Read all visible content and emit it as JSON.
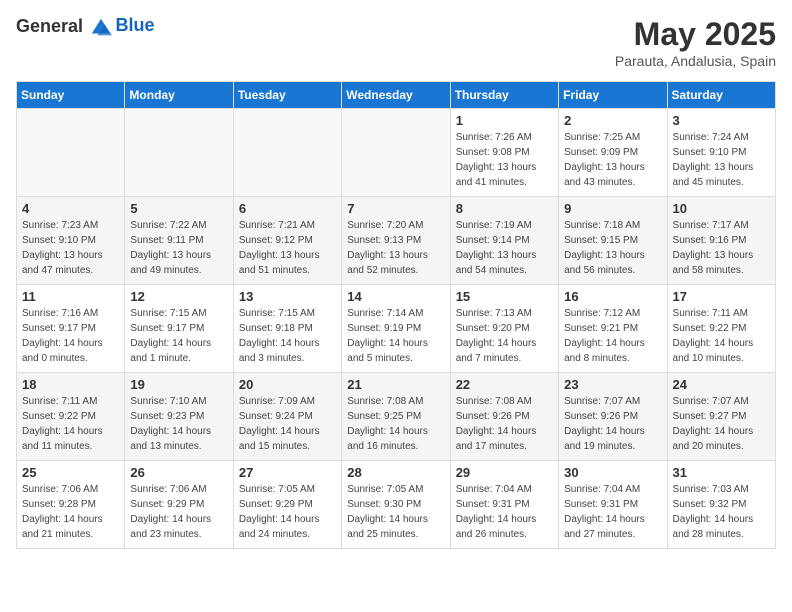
{
  "logo": {
    "general": "General",
    "blue": "Blue"
  },
  "title": "May 2025",
  "subtitle": "Parauta, Andalusia, Spain",
  "days_of_week": [
    "Sunday",
    "Monday",
    "Tuesday",
    "Wednesday",
    "Thursday",
    "Friday",
    "Saturday"
  ],
  "weeks": [
    [
      {
        "day": "",
        "info": ""
      },
      {
        "day": "",
        "info": ""
      },
      {
        "day": "",
        "info": ""
      },
      {
        "day": "",
        "info": ""
      },
      {
        "day": "1",
        "info": "Sunrise: 7:26 AM\nSunset: 9:08 PM\nDaylight: 13 hours\nand 41 minutes."
      },
      {
        "day": "2",
        "info": "Sunrise: 7:25 AM\nSunset: 9:09 PM\nDaylight: 13 hours\nand 43 minutes."
      },
      {
        "day": "3",
        "info": "Sunrise: 7:24 AM\nSunset: 9:10 PM\nDaylight: 13 hours\nand 45 minutes."
      }
    ],
    [
      {
        "day": "4",
        "info": "Sunrise: 7:23 AM\nSunset: 9:10 PM\nDaylight: 13 hours\nand 47 minutes."
      },
      {
        "day": "5",
        "info": "Sunrise: 7:22 AM\nSunset: 9:11 PM\nDaylight: 13 hours\nand 49 minutes."
      },
      {
        "day": "6",
        "info": "Sunrise: 7:21 AM\nSunset: 9:12 PM\nDaylight: 13 hours\nand 51 minutes."
      },
      {
        "day": "7",
        "info": "Sunrise: 7:20 AM\nSunset: 9:13 PM\nDaylight: 13 hours\nand 52 minutes."
      },
      {
        "day": "8",
        "info": "Sunrise: 7:19 AM\nSunset: 9:14 PM\nDaylight: 13 hours\nand 54 minutes."
      },
      {
        "day": "9",
        "info": "Sunrise: 7:18 AM\nSunset: 9:15 PM\nDaylight: 13 hours\nand 56 minutes."
      },
      {
        "day": "10",
        "info": "Sunrise: 7:17 AM\nSunset: 9:16 PM\nDaylight: 13 hours\nand 58 minutes."
      }
    ],
    [
      {
        "day": "11",
        "info": "Sunrise: 7:16 AM\nSunset: 9:17 PM\nDaylight: 14 hours\nand 0 minutes."
      },
      {
        "day": "12",
        "info": "Sunrise: 7:15 AM\nSunset: 9:17 PM\nDaylight: 14 hours\nand 1 minute."
      },
      {
        "day": "13",
        "info": "Sunrise: 7:15 AM\nSunset: 9:18 PM\nDaylight: 14 hours\nand 3 minutes."
      },
      {
        "day": "14",
        "info": "Sunrise: 7:14 AM\nSunset: 9:19 PM\nDaylight: 14 hours\nand 5 minutes."
      },
      {
        "day": "15",
        "info": "Sunrise: 7:13 AM\nSunset: 9:20 PM\nDaylight: 14 hours\nand 7 minutes."
      },
      {
        "day": "16",
        "info": "Sunrise: 7:12 AM\nSunset: 9:21 PM\nDaylight: 14 hours\nand 8 minutes."
      },
      {
        "day": "17",
        "info": "Sunrise: 7:11 AM\nSunset: 9:22 PM\nDaylight: 14 hours\nand 10 minutes."
      }
    ],
    [
      {
        "day": "18",
        "info": "Sunrise: 7:11 AM\nSunset: 9:22 PM\nDaylight: 14 hours\nand 11 minutes."
      },
      {
        "day": "19",
        "info": "Sunrise: 7:10 AM\nSunset: 9:23 PM\nDaylight: 14 hours\nand 13 minutes."
      },
      {
        "day": "20",
        "info": "Sunrise: 7:09 AM\nSunset: 9:24 PM\nDaylight: 14 hours\nand 15 minutes."
      },
      {
        "day": "21",
        "info": "Sunrise: 7:08 AM\nSunset: 9:25 PM\nDaylight: 14 hours\nand 16 minutes."
      },
      {
        "day": "22",
        "info": "Sunrise: 7:08 AM\nSunset: 9:26 PM\nDaylight: 14 hours\nand 17 minutes."
      },
      {
        "day": "23",
        "info": "Sunrise: 7:07 AM\nSunset: 9:26 PM\nDaylight: 14 hours\nand 19 minutes."
      },
      {
        "day": "24",
        "info": "Sunrise: 7:07 AM\nSunset: 9:27 PM\nDaylight: 14 hours\nand 20 minutes."
      }
    ],
    [
      {
        "day": "25",
        "info": "Sunrise: 7:06 AM\nSunset: 9:28 PM\nDaylight: 14 hours\nand 21 minutes."
      },
      {
        "day": "26",
        "info": "Sunrise: 7:06 AM\nSunset: 9:29 PM\nDaylight: 14 hours\nand 23 minutes."
      },
      {
        "day": "27",
        "info": "Sunrise: 7:05 AM\nSunset: 9:29 PM\nDaylight: 14 hours\nand 24 minutes."
      },
      {
        "day": "28",
        "info": "Sunrise: 7:05 AM\nSunset: 9:30 PM\nDaylight: 14 hours\nand 25 minutes."
      },
      {
        "day": "29",
        "info": "Sunrise: 7:04 AM\nSunset: 9:31 PM\nDaylight: 14 hours\nand 26 minutes."
      },
      {
        "day": "30",
        "info": "Sunrise: 7:04 AM\nSunset: 9:31 PM\nDaylight: 14 hours\nand 27 minutes."
      },
      {
        "day": "31",
        "info": "Sunrise: 7:03 AM\nSunset: 9:32 PM\nDaylight: 14 hours\nand 28 minutes."
      }
    ]
  ]
}
